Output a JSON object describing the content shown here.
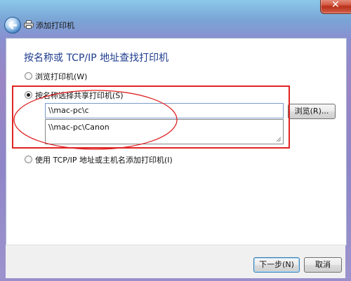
{
  "window": {
    "title": "添加打印机",
    "close_glyph": "✕"
  },
  "content": {
    "heading": "按名称或 TCP/IP 地址查找打印机"
  },
  "options": [
    {
      "label": "浏览打印机(W)",
      "checked": false
    },
    {
      "label": "按名称选择共享打印机(S)",
      "checked": true
    },
    {
      "label": "使用 TCP/IP 地址或主机名添加打印机(I)",
      "checked": false
    }
  ],
  "printer_input": {
    "value": "\\\\mac-pc\\c"
  },
  "autocomplete": {
    "items": [
      "\\\\mac-pc\\Canon"
    ]
  },
  "buttons": {
    "browse": "浏览(R)...",
    "next": "下一步(N)",
    "cancel": "取消"
  },
  "icons": {
    "back": "back-arrow-icon",
    "printer": "printer-icon",
    "close": "close-icon"
  },
  "colors": {
    "heading": "#1e3c8f",
    "highlight_annotation": "#e02424"
  }
}
